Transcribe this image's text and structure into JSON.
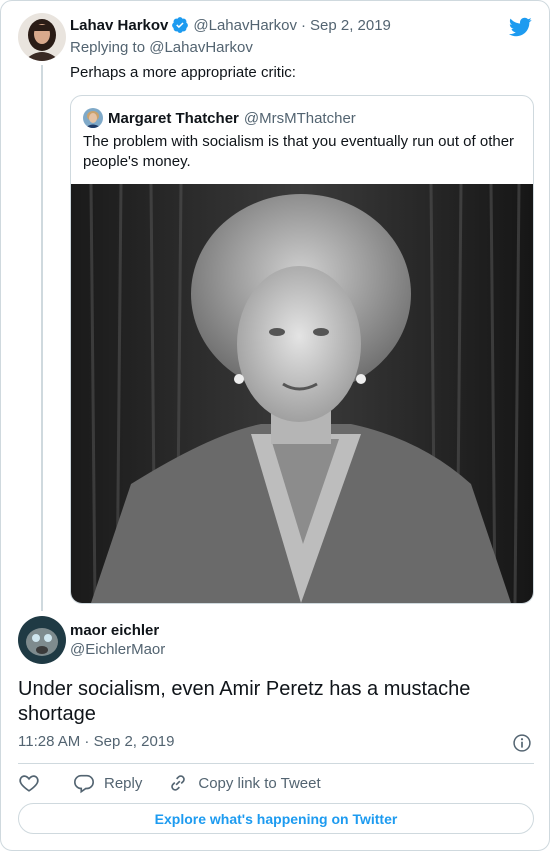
{
  "colors": {
    "accent": "#1d9bf0",
    "muted": "#536471",
    "text": "#0f1419",
    "border": "#cfd9de"
  },
  "parent_tweet": {
    "author_name": "Lahav Harkov",
    "verified": true,
    "handle": "@LahavHarkov",
    "separator": "·",
    "date": "Sep 2, 2019",
    "replying_prefix": "Replying to",
    "replying_to": "@LahavHarkov",
    "text": "Perhaps a more appropriate critic:"
  },
  "quoted_tweet": {
    "author_name": "Margaret Thatcher",
    "handle": "@MrsMThatcher",
    "text": "The problem with socialism is that you eventually run out of other people's money."
  },
  "main_tweet": {
    "author_name": "maor eichler",
    "handle": "@EichlerMaor",
    "text": "Under socialism, even Amir Peretz has a mustache shortage",
    "timestamp": "11:28 AM · Sep 2, 2019"
  },
  "actions": {
    "reply_label": "Reply",
    "copy_link_label": "Copy link to Tweet",
    "explore_label": "Explore what's happening on Twitter"
  },
  "icons": [
    "twitter-bird-icon",
    "verified-badge-icon",
    "info-icon",
    "heart-icon",
    "reply-icon",
    "link-icon"
  ]
}
